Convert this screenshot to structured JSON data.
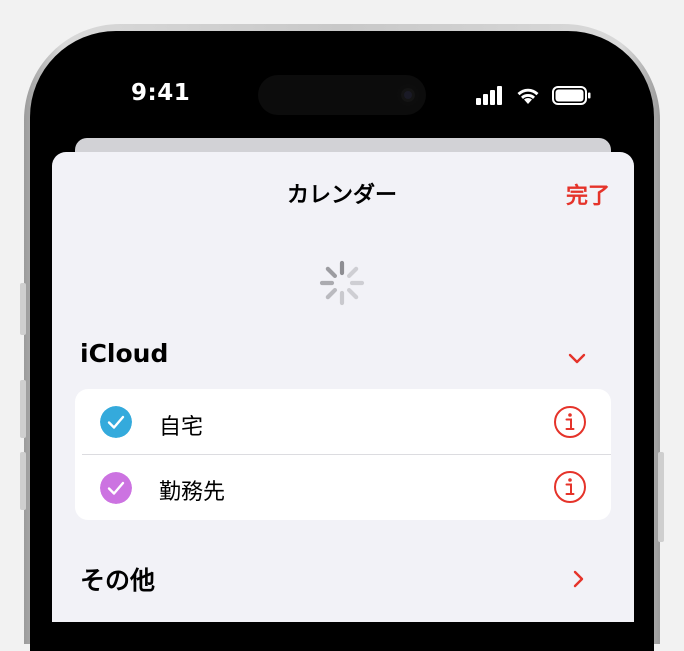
{
  "status_bar": {
    "time": "9:41"
  },
  "sheet": {
    "title": "カレンダー",
    "done_label": "完了"
  },
  "sections": [
    {
      "header": "iCloud",
      "expanded": true,
      "calendars": [
        {
          "label": "自宅",
          "checked": true,
          "color": "#34aadc"
        },
        {
          "label": "勤務先",
          "checked": true,
          "color": "#cc73e1"
        }
      ]
    },
    {
      "header": "その他",
      "expanded": false
    }
  ],
  "colors": {
    "accent": "#e5332a",
    "sheet_background": "#f2f2f7"
  }
}
